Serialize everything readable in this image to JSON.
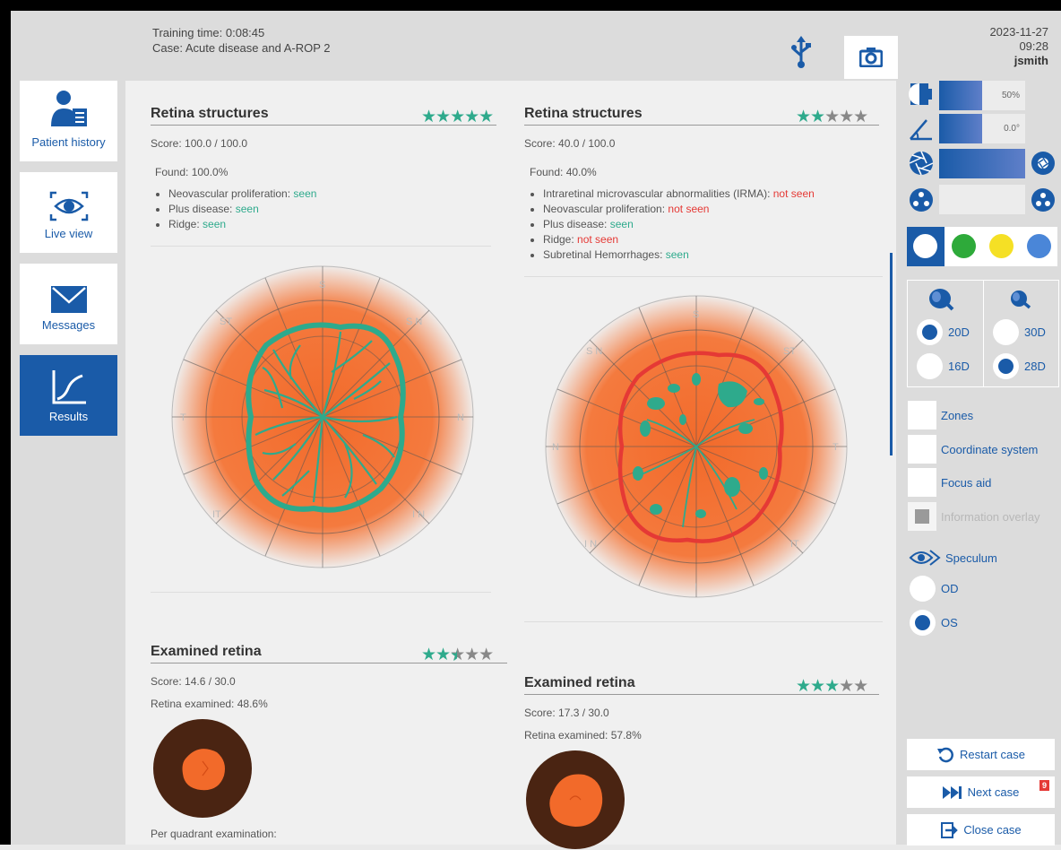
{
  "header": {
    "training_time": "Training time: 0:08:45",
    "case": "Case: Acute disease and A-ROP 2",
    "date": "2023-11-27",
    "time": "09:28",
    "user": "jsmith"
  },
  "nav": {
    "items": [
      {
        "label": "Patient history",
        "icon": "patient-history-icon"
      },
      {
        "label": "Live view",
        "icon": "eye-icon"
      },
      {
        "label": "Messages",
        "icon": "envelope-icon"
      },
      {
        "label": "Results",
        "icon": "chart-icon",
        "active": true
      }
    ]
  },
  "results": {
    "left": {
      "structures": {
        "title": "Retina structures",
        "stars": 5,
        "score": "Score: 100.0 / 100.0",
        "found": "Found: 100.0%",
        "items": [
          {
            "name": "Neovascular proliferation:",
            "status": "seen"
          },
          {
            "name": "Plus disease:",
            "status": "seen"
          },
          {
            "name": "Ridge:",
            "status": "seen"
          }
        ],
        "chart_labels": {
          "top": "S",
          "topleft": "ST",
          "topright": "S N",
          "left": "T",
          "right": "N",
          "bottomleft": "IT",
          "bottomright": "I N",
          "bottom": "I"
        }
      },
      "examined": {
        "title": "Examined retina",
        "stars": 2.5,
        "score": "Score: 14.6 / 30.0",
        "examined": "Retina examined: 48.6%",
        "per_quadrant": "Per quadrant examination:"
      }
    },
    "right": {
      "structures": {
        "title": "Retina structures",
        "stars": 2,
        "score": "Score: 40.0 / 100.0",
        "found": "Found: 40.0%",
        "items": [
          {
            "name": "Intraretinal microvascular abnormalities (IRMA):",
            "status": "not seen"
          },
          {
            "name": "Neovascular proliferation:",
            "status": "not seen"
          },
          {
            "name": "Plus disease:",
            "status": "seen"
          },
          {
            "name": "Ridge:",
            "status": "not seen"
          },
          {
            "name": "Subretinal Hemorrhages:",
            "status": "seen"
          }
        ],
        "chart_labels": {
          "top": "S",
          "topleft": "S N",
          "topright": "ST",
          "left": "N",
          "right": "T",
          "bottomleft": "I N",
          "bottomright": "IT",
          "bottom": "I"
        }
      },
      "examined": {
        "title": "Examined retina",
        "stars": 3,
        "score": "Score: 17.3 / 30.0",
        "examined": "Retina examined: 57.8%"
      }
    }
  },
  "side": {
    "sliders": [
      {
        "icon": "brightness-icon",
        "value": "50%",
        "level": 0.5
      },
      {
        "icon": "angle-icon",
        "value": "0.0°",
        "level": 0.5
      },
      {
        "icon": "aperture-icon",
        "value": "",
        "level": 1.0
      },
      {
        "icon": "dots-icon",
        "value": "",
        "level": 0.0
      }
    ],
    "colors": [
      "#ffffff",
      "#2eaa3a",
      "#f5e025",
      "#4a86d8"
    ],
    "lens_options": [
      {
        "label": "20D",
        "on": true
      },
      {
        "label": "30D",
        "on": false
      },
      {
        "label": "16D",
        "on": false
      },
      {
        "label": "28D",
        "on": true
      }
    ],
    "checkboxes": [
      "Zones",
      "Coordinate system",
      "Focus aid",
      "Information overlay"
    ],
    "speculum": "Speculum",
    "eye_options": [
      {
        "label": "OD",
        "on": false
      },
      {
        "label": "OS",
        "on": true
      }
    ],
    "buttons": {
      "restart": "Restart case",
      "next": "Next case",
      "next_badge": "9",
      "close": "Close case"
    }
  }
}
